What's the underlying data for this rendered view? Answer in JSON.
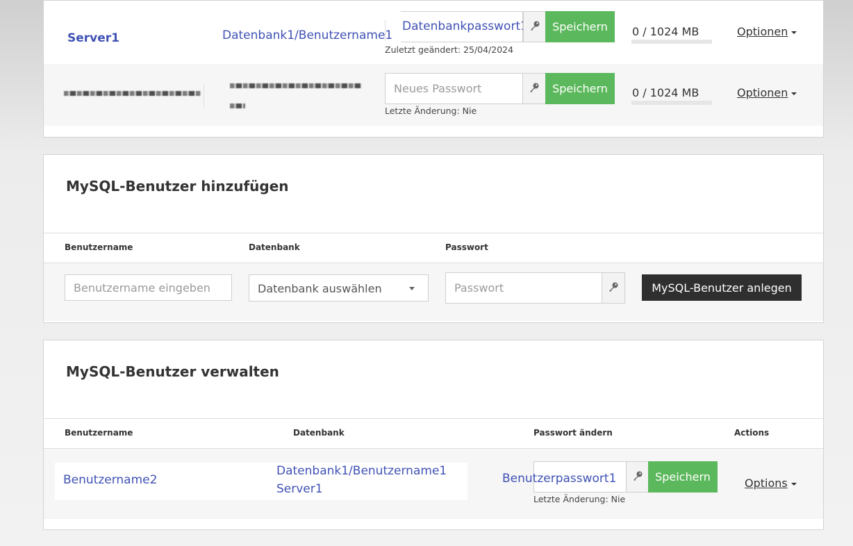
{
  "databases": {
    "rows": [
      {
        "server": "Server1",
        "database": "Datenbank1/Benutzername1",
        "password_value": "Datenbankpasswort1",
        "password_placeholder": "",
        "save_label": "Speichern",
        "change_note": "Zuletzt geändert: 25/04/2024",
        "usage": "0 / 1024 MB",
        "usage_fraction": 0,
        "options_label": "Optionen"
      },
      {
        "server": "",
        "database": "",
        "password_value": "",
        "password_placeholder": "Neues Passwort",
        "save_label": "Speichern",
        "change_note": "Letzte Änderung: Nie",
        "usage": "0 / 1024 MB",
        "usage_fraction": 0,
        "options_label": "Optionen"
      }
    ]
  },
  "add_user": {
    "title": "MySQL-Benutzer hinzufügen",
    "columns": [
      "Benutzername",
      "Datenbank",
      "Passwort"
    ],
    "username_placeholder": "Benutzername eingeben",
    "database_select": "Datenbank auswählen",
    "password_placeholder": "Passwort",
    "create_label": "MySQL-Benutzer anlegen"
  },
  "manage_users": {
    "title": "MySQL-Benutzer verwalten",
    "columns": [
      "Benutzername",
      "Datenbank",
      "Passwort ändern",
      "Actions"
    ],
    "rows": [
      {
        "username": "Benutzername2",
        "database_line1": "Datenbank1/Benutzername1",
        "database_line2": "Server1",
        "password_value": "Benutzerpasswort1",
        "save_label": "Speichern",
        "change_note": "Letzte Änderung: Nie",
        "options_label": "Options"
      }
    ]
  },
  "colors": {
    "save_green": "#5cb85c",
    "create_dark": "#2f2f2f",
    "link_blue": "#3f51b5"
  },
  "icons": [
    "key-icon",
    "caret-down-icon",
    "chevron-down-icon"
  ]
}
